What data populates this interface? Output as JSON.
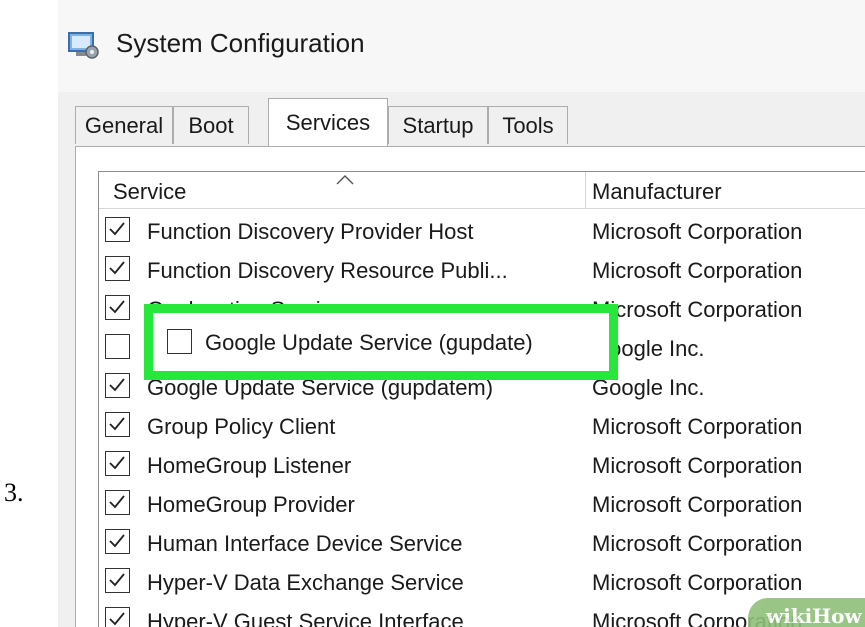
{
  "step_number": "3.",
  "window": {
    "title": "System Configuration"
  },
  "tabs": [
    {
      "label": "General",
      "active": false
    },
    {
      "label": "Boot",
      "active": false
    },
    {
      "label": "Services",
      "active": true
    },
    {
      "label": "Startup",
      "active": false
    },
    {
      "label": "Tools",
      "active": false
    }
  ],
  "columns": {
    "service": "Service",
    "manufacturer": "Manufacturer"
  },
  "services": [
    {
      "name": "Function Discovery Provider Host",
      "manufacturer": "Microsoft Corporation",
      "checked": true
    },
    {
      "name": "Function Discovery Resource Publi...",
      "manufacturer": "Microsoft Corporation",
      "checked": true
    },
    {
      "name": "Geolocation Service",
      "manufacturer": "Microsoft Corporation",
      "checked": true
    },
    {
      "name": "Google Update Service (gupdate)",
      "manufacturer": "Google Inc.",
      "checked": false
    },
    {
      "name": "Google Update Service (gupdatem)",
      "manufacturer": "Google Inc.",
      "checked": true
    },
    {
      "name": "Group Policy Client",
      "manufacturer": "Microsoft Corporation",
      "checked": true
    },
    {
      "name": "HomeGroup Listener",
      "manufacturer": "Microsoft Corporation",
      "checked": true
    },
    {
      "name": "HomeGroup Provider",
      "manufacturer": "Microsoft Corporation",
      "checked": true
    },
    {
      "name": "Human Interface Device Service",
      "manufacturer": "Microsoft Corporation",
      "checked": true
    },
    {
      "name": "Hyper-V Data Exchange Service",
      "manufacturer": "Microsoft Corporation",
      "checked": true
    },
    {
      "name": "Hyper-V Guest Service Interface",
      "manufacturer": "Microsoft Corporation",
      "checked": true
    }
  ],
  "highlight": {
    "name": "Google Update Service (gupdate)",
    "checked": false,
    "color": "#27e83a"
  },
  "watermark": "wikiHow",
  "icons": {
    "app": "system-config-icon",
    "sort": "sort-ascending-icon",
    "check": "checkmark-icon"
  }
}
